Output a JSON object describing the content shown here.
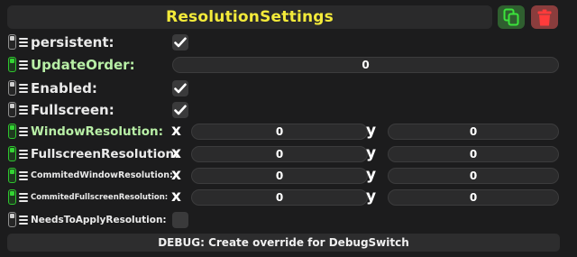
{
  "header": {
    "title": "ResolutionSettings",
    "copy_icon": "copy-icon",
    "delete_icon": "trash-icon"
  },
  "colors": {
    "title": "#f3ea3a",
    "toggle_on": "#2ec42e",
    "toggle_off": "#8f8f8f",
    "copy_button": "#2f5f2f",
    "delete_button": "#8a3d3d",
    "label_green": "#b8efa6"
  },
  "fields": [
    {
      "id": "persistent",
      "label": "persistent:",
      "type": "checkbox",
      "checked": true,
      "toggle_on": false
    },
    {
      "id": "update-order",
      "label": "UpdateOrder:",
      "type": "number",
      "value": "0",
      "toggle_on": true
    },
    {
      "id": "enabled",
      "label": "Enabled:",
      "type": "checkbox",
      "checked": true,
      "toggle_on": false
    },
    {
      "id": "fullscreen",
      "label": "Fullscreen:",
      "type": "checkbox",
      "checked": true,
      "toggle_on": false
    },
    {
      "id": "window-resolution",
      "label": "WindowResolution:",
      "type": "vector2",
      "x_label": "x",
      "x": "0",
      "y_label": "y",
      "y": "0",
      "toggle_on": true
    },
    {
      "id": "fullscreen-resolution",
      "label": "FullscreenResolution:",
      "type": "vector2",
      "x_label": "x",
      "x": "0",
      "y_label": "y",
      "y": "0",
      "toggle_on": true
    },
    {
      "id": "commited-window-resolution",
      "label": "CommitedWindowResolution:",
      "type": "vector2",
      "x_label": "x",
      "x": "0",
      "y_label": "y",
      "y": "0",
      "toggle_on": true
    },
    {
      "id": "commited-fullscreen-resolution",
      "label": "CommitedFullscreenResolution:",
      "type": "vector2",
      "x_label": "x",
      "x": "0",
      "y_label": "y",
      "y": "0",
      "toggle_on": true
    },
    {
      "id": "needs-to-apply-resolution",
      "label": "NeedsToApplyResolution:",
      "type": "checkbox",
      "checked": false,
      "toggle_on": false
    }
  ],
  "footer": {
    "debug_label": "DEBUG: Create override for DebugSwitch"
  }
}
